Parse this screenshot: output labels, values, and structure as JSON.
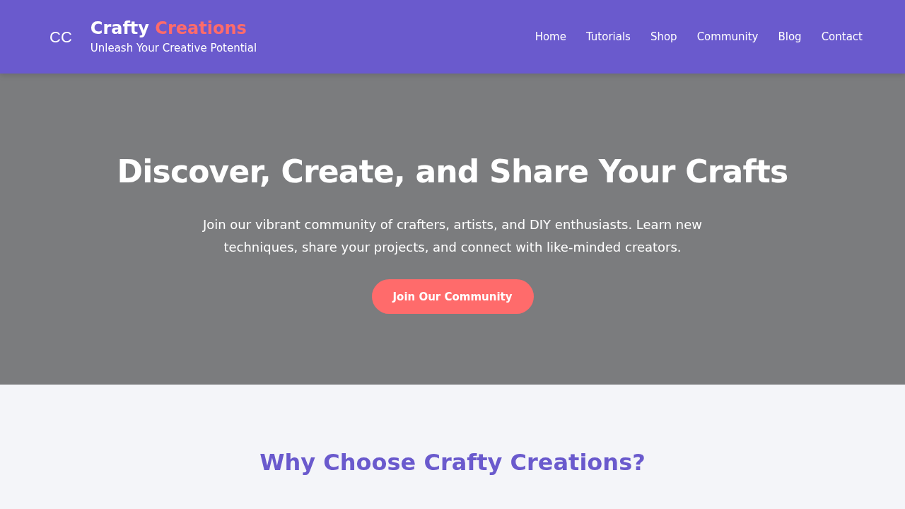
{
  "header": {
    "logo": "CC",
    "brand_name": "Crafty",
    "brand_accent": "Creations",
    "tagline": "Unleash Your Creative Potential",
    "nav": [
      {
        "label": "Home"
      },
      {
        "label": "Tutorials"
      },
      {
        "label": "Shop"
      },
      {
        "label": "Community"
      },
      {
        "label": "Blog"
      },
      {
        "label": "Contact"
      }
    ]
  },
  "hero": {
    "title": "Discover, Create, and Share Your Crafts",
    "text": "Join our vibrant community of crafters, artists, and DIY enthusiasts. Learn new techniques, share your projects, and connect with like-minded creators.",
    "button": "Join Our Community"
  },
  "features": {
    "title": "Why Choose Crafty Creations?"
  }
}
